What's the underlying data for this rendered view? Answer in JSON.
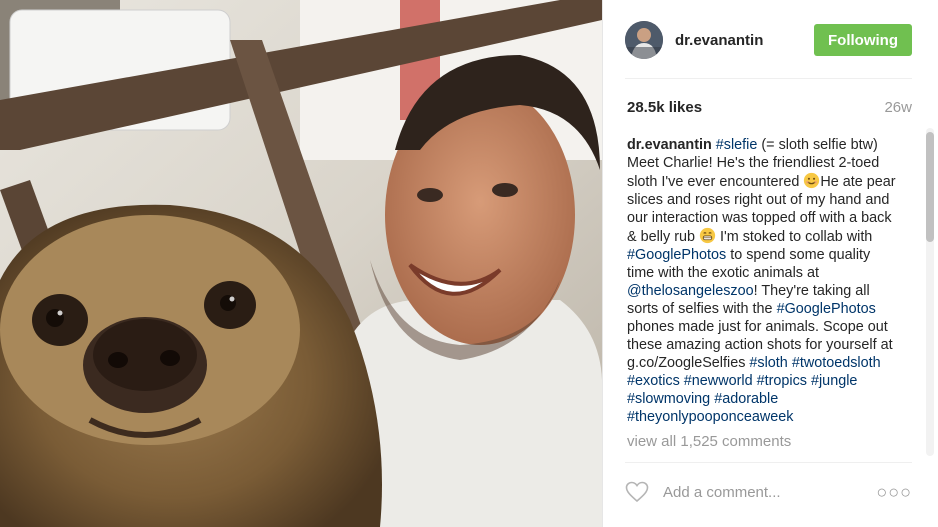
{
  "post": {
    "username": "dr.evanantin",
    "follow_label": "Following",
    "likes": "28.5k likes",
    "age": "26w",
    "caption": {
      "author": "dr.evanantin",
      "tag1": "#slefie",
      "t1": " (= sloth selfie btw) Meet Charlie! He's the friendliest 2-toed sloth I've ever encountered ",
      "t2": "He ate pear slices and roses right out of my hand and our interaction was topped off with a back & belly rub ",
      "t3": " I'm stoked to collab with ",
      "tag2": "#GooglePhotos",
      "t4": " to spend some quality time with the exotic animals at ",
      "mention": "@thelosangeleszoo",
      "t5": "! They're taking all sorts of selfies with the ",
      "tag3": "#GooglePhotos",
      "t6": " phones made just for animals. Scope out these amazing action shots for yourself at g.co/ZoogleSelfies ",
      "tags": [
        "#sloth",
        "#twotoedsloth",
        "#exotics",
        "#newworld",
        "#tropics",
        "#jungle",
        "#slowmoving",
        "#adorable",
        "#theyonlypooponceaweek"
      ]
    },
    "view_all": "view all 1,525 comments",
    "comment_placeholder": "Add a comment...",
    "more_label": "○○○"
  },
  "icons": {
    "heart": "heart-outline-icon",
    "smile_emoji": "smiling-face-emoji",
    "grin_emoji": "grinning-face-emoji"
  },
  "colors": {
    "follow_button": "#70c050",
    "hashtag": "#003569",
    "muted": "#999999"
  }
}
